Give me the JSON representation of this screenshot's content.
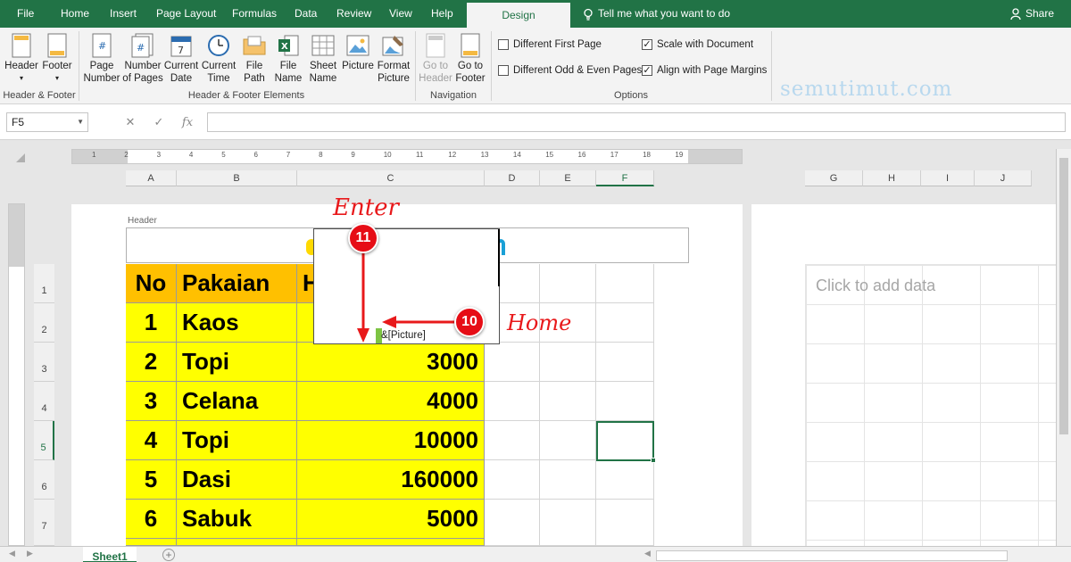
{
  "ribbon_tabs": [
    "File",
    "Home",
    "Insert",
    "Page Layout",
    "Formulas",
    "Data",
    "Review",
    "View",
    "Help",
    "Design"
  ],
  "active_tab": "Design",
  "tell_me": "Tell me what you want to do",
  "share": "Share",
  "groups": {
    "header_footer": {
      "label": "Header & Footer",
      "header": "Header",
      "footer": "Footer"
    },
    "elements": {
      "label": "Header & Footer Elements",
      "buttons": [
        {
          "l1": "Page",
          "l2": "Number"
        },
        {
          "l1": "Number",
          "l2": "of Pages"
        },
        {
          "l1": "Current",
          "l2": "Date"
        },
        {
          "l1": "Current",
          "l2": "Time"
        },
        {
          "l1": "File",
          "l2": "Path"
        },
        {
          "l1": "File",
          "l2": "Name"
        },
        {
          "l1": "Sheet",
          "l2": "Name"
        },
        {
          "l1": "Picture",
          "l2": ""
        },
        {
          "l1": "Format",
          "l2": "Picture"
        }
      ]
    },
    "navigation": {
      "label": "Navigation",
      "buttons": [
        {
          "l1": "Go to",
          "l2": "Header"
        },
        {
          "l1": "Go to",
          "l2": "Footer"
        }
      ]
    },
    "options": {
      "label": "Options",
      "checks": [
        {
          "label": "Different First Page",
          "checked": false
        },
        {
          "label": "Scale with Document",
          "checked": true
        },
        {
          "label": "Different Odd & Even Pages",
          "checked": false
        },
        {
          "label": "Align with Page Margins",
          "checked": true
        }
      ]
    }
  },
  "watermark": "semutimut.com",
  "name_box": "F5",
  "fx": "fx",
  "columns": [
    "A",
    "B",
    "C",
    "D",
    "E",
    "F",
    "G",
    "H",
    "I",
    "J"
  ],
  "rows": [
    "1",
    "2",
    "3",
    "4",
    "5",
    "6",
    "7"
  ],
  "ruler_numbers": [
    "1",
    "2",
    "3",
    "4",
    "5",
    "6",
    "7",
    "8",
    "9",
    "10",
    "11",
    "12",
    "13",
    "14",
    "15",
    "16",
    "17",
    "18",
    "19"
  ],
  "page_header_label": "Header",
  "table": {
    "headers": [
      "No",
      "Pakaian",
      "H"
    ],
    "rows": [
      {
        "no": "1",
        "item": "Kaos",
        "price": ""
      },
      {
        "no": "2",
        "item": "Topi",
        "price": "3000"
      },
      {
        "no": "3",
        "item": "Celana",
        "price": "4000"
      },
      {
        "no": "4",
        "item": "Topi",
        "price": "10000"
      },
      {
        "no": "5",
        "item": "Dasi",
        "price": "160000"
      },
      {
        "no": "6",
        "item": "Sabuk",
        "price": "5000"
      }
    ]
  },
  "popup_text": "&[Picture]",
  "annotations": {
    "enter": "Enter",
    "home": "Home",
    "badge_enter": "11",
    "badge_home": "10"
  },
  "click_to_add": "Click to add data",
  "sheet_tab": "Sheet1",
  "colors": {
    "excel_green": "#217346",
    "header_fill": "#ffc000",
    "data_fill": "#ffff00",
    "annotation_red": "#e8191b"
  }
}
